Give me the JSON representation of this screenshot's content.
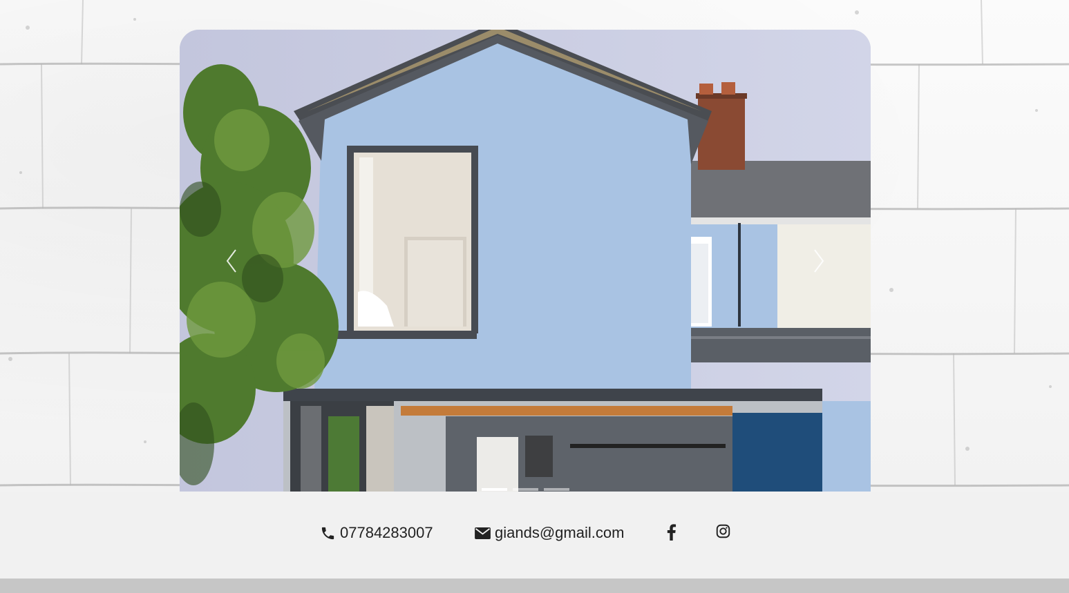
{
  "carousel": {
    "slides": [
      {
        "alt": "",
        "active": true
      },
      {
        "alt": "",
        "active": false
      },
      {
        "alt": "",
        "active": false
      }
    ],
    "prev_icon": "chevron-left-icon",
    "next_icon": "chevron-right-icon"
  },
  "contact": {
    "phone": "07784283007",
    "phone_icon": "phone-icon",
    "email": "giands@gmail.com",
    "email_icon": "envelope-icon",
    "facebook_icon": "facebook-icon",
    "instagram_icon": "instagram-icon"
  },
  "colors": {
    "contact_bar": "#f1f1f1",
    "bottom_strip": "#c6c6c6",
    "text": "#222222",
    "house_wall": "#a9c3e3"
  }
}
